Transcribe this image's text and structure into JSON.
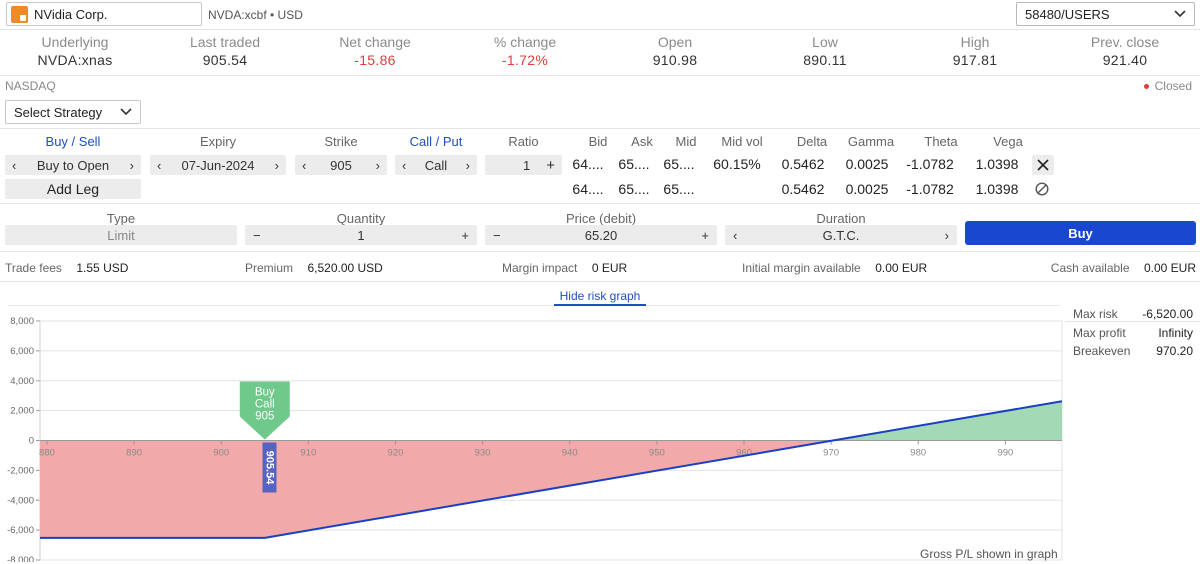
{
  "header": {
    "search_value": "NVidia Corp.",
    "symbol_info": "NVDA:xcbf • USD",
    "account": "58480/USERS"
  },
  "quote": [
    {
      "label": "Underlying",
      "value": "NVDA:xnas",
      "negative": false
    },
    {
      "label": "Last traded",
      "value": "905.54",
      "negative": false
    },
    {
      "label": "Net change",
      "value": "-15.86",
      "negative": true
    },
    {
      "label": "% change",
      "value": "-1.72%",
      "negative": true
    },
    {
      "label": "Open",
      "value": "910.98",
      "negative": false
    },
    {
      "label": "Low",
      "value": "890.11",
      "negative": false
    },
    {
      "label": "High",
      "value": "917.81",
      "negative": false
    },
    {
      "label": "Prev. close",
      "value": "921.40",
      "negative": false
    }
  ],
  "market": {
    "exchange": "NASDAQ",
    "status": "Closed"
  },
  "strategy": {
    "label": "Select Strategy"
  },
  "legs_header": {
    "buy_sell": "Buy / Sell",
    "expiry": "Expiry",
    "strike": "Strike",
    "call_put": "Call / Put",
    "ratio": "Ratio",
    "bid": "Bid",
    "ask": "Ask",
    "mid": "Mid",
    "mid_vol": "Mid vol",
    "delta": "Delta",
    "gamma": "Gamma",
    "theta": "Theta",
    "vega": "Vega"
  },
  "leg": {
    "side": "Buy to Open",
    "expiry": "07-Jun-2024",
    "strike": "905",
    "type": "Call",
    "ratio": "1",
    "bid": "64....",
    "ask": "65....",
    "mid": "65....",
    "mid_vol": "60.15%",
    "delta": "0.5462",
    "gamma": "0.0025",
    "theta": "-1.0782",
    "vega": "1.0398"
  },
  "total": {
    "bid": "64....",
    "ask": "65....",
    "mid": "65....",
    "delta": "0.5462",
    "gamma": "0.0025",
    "theta": "-1.0782",
    "vega": "1.0398"
  },
  "add_leg_label": "Add Leg",
  "order": {
    "type_label": "Type",
    "type_value": "Limit",
    "quantity_label": "Quantity",
    "quantity_value": "1",
    "price_label": "Price (debit)",
    "price_value": "65.20",
    "duration_label": "Duration",
    "duration_value": "G.T.C.",
    "buy_label": "Buy"
  },
  "summary": {
    "trade_fees_label": "Trade fees",
    "trade_fees": "1.55 USD",
    "premium_label": "Premium",
    "premium": "6,520.00 USD",
    "margin_impact_label": "Margin impact",
    "margin_impact": "0 EUR",
    "initial_margin_label": "Initial margin available",
    "initial_margin": "0.00 EUR",
    "cash_label": "Cash available",
    "cash": "0.00 EUR"
  },
  "risk_toggle": "Hide risk graph",
  "risk_stats": {
    "max_risk_label": "Max risk",
    "max_risk": "-6,520.00",
    "max_profit_label": "Max profit",
    "max_profit": "Infinity",
    "breakeven_label": "Breakeven",
    "breakeven": "970.20"
  },
  "chart_footer": "Gross P/L shown in graph",
  "marker": {
    "line1": "Buy",
    "line2": "Call",
    "line3": "905",
    "current_price_label": "905.54"
  },
  "colors": {
    "loss_fill": "#f2a9a9",
    "profit_fill": "#a4d9b6",
    "payoff_line": "#1a3fc4",
    "buy_button": "#1a47d0",
    "marker_green": "#6fc98a",
    "marker_blue": "#5663c4"
  },
  "chart_data": {
    "type": "line",
    "x_ticks": [
      880,
      890,
      900,
      910,
      920,
      930,
      940,
      950,
      960,
      970,
      980,
      990
    ],
    "y_ticks": [
      8000,
      6000,
      4000,
      2000,
      0,
      -2000,
      -4000,
      -6000,
      -8000
    ],
    "y_tick_labels": [
      "8,000",
      "6,000",
      "4,000",
      "2,000",
      "0",
      "-2,000",
      "-4,000",
      "-6,000",
      "-8,000"
    ],
    "xlim": [
      879.2,
      996.5
    ],
    "ylim": [
      -8000,
      8000
    ],
    "strike": 905,
    "current_price": 905.54,
    "series": [
      {
        "x": [
          879.2,
          905,
          970.2,
          996.5
        ],
        "y": [
          -6520,
          -6520,
          0,
          2630
        ]
      }
    ],
    "grid": true
  }
}
